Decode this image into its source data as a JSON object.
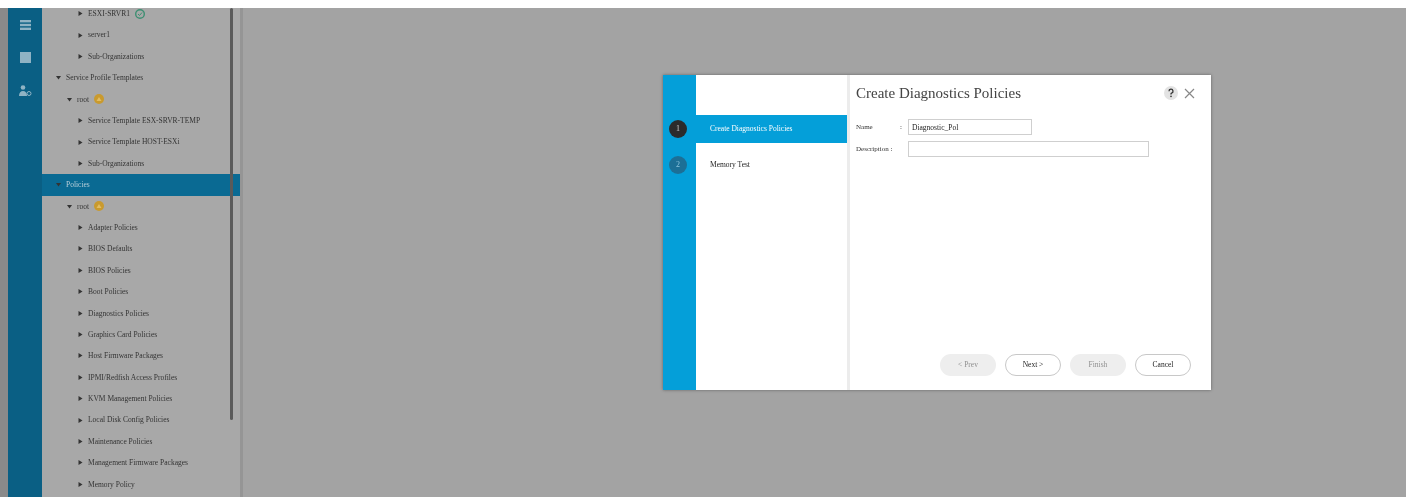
{
  "rail": {
    "icons": [
      {
        "kind": "menu",
        "selected": false
      },
      {
        "kind": "square",
        "selected": false
      },
      {
        "kind": "person",
        "selected": false
      }
    ]
  },
  "tree": {
    "cut_off_branch": [
      {
        "label": "ESXI-SRVR1",
        "badge": {
          "kind": "check"
        },
        "expanded": false
      },
      {
        "label": "server1",
        "expanded": false
      },
      {
        "label": "Sub-Organizations",
        "expanded": false
      }
    ],
    "items": [
      {
        "label": "Service Profile Templates",
        "expanded": true,
        "selected": false,
        "children": [
          {
            "label": "root",
            "badge": {
              "kind": "org"
            },
            "expanded": true,
            "selected": false,
            "children": [
              {
                "label": "Service Template ESX-SRVR-TEMP",
                "expanded": false,
                "selected": false
              },
              {
                "label": "Service Template HOST-ESXi",
                "expanded": false,
                "selected": false
              },
              {
                "label": "Sub-Organizations",
                "expanded": false,
                "selected": false
              }
            ]
          }
        ]
      },
      {
        "label": "Policies",
        "expanded": true,
        "selected": true,
        "children": [
          {
            "label": "root",
            "badge": {
              "kind": "org"
            },
            "expanded": true,
            "selected": false,
            "children": [
              {
                "label": "Adapter Policies",
                "expanded": false,
                "selected": false
              },
              {
                "label": "BIOS Defaults",
                "expanded": false,
                "selected": false
              },
              {
                "label": "BIOS Policies",
                "expanded": false,
                "selected": false
              },
              {
                "label": "Boot Policies",
                "expanded": false,
                "selected": false
              },
              {
                "label": "Diagnostics Policies",
                "expanded": false,
                "selected": false
              },
              {
                "label": "Graphics Card Policies",
                "expanded": false,
                "selected": false
              },
              {
                "label": "Host Firmware Packages",
                "expanded": false,
                "selected": false
              },
              {
                "label": "IPMI/Redfish Access Profiles",
                "expanded": false,
                "selected": false
              },
              {
                "label": "KVM Management Policies",
                "expanded": false,
                "selected": false
              },
              {
                "label": "Local Disk Config Policies",
                "expanded": false,
                "selected": false
              },
              {
                "label": "Maintenance Policies",
                "expanded": false,
                "selected": false
              },
              {
                "label": "Management Firmware Packages",
                "expanded": false,
                "selected": false
              },
              {
                "label": "Memory Policy",
                "expanded": false,
                "selected": false
              }
            ]
          }
        ]
      }
    ]
  },
  "dialog": {
    "title": "Create Diagnostics Policies",
    "steps": [
      {
        "number": "1",
        "label": "Create Diagnostics Policies",
        "selected": true
      },
      {
        "number": "2",
        "label": "Memory Test",
        "selected": false
      }
    ],
    "fields": [
      {
        "label": "Name",
        "separator": ":",
        "value": "Diagnostic_Pol",
        "wide": false
      },
      {
        "label": "Description :",
        "wide": true
      }
    ],
    "buttons": [
      {
        "label": "< Prev",
        "disabled": true
      },
      {
        "label": "Next >",
        "disabled": false
      },
      {
        "label": "Finish",
        "disabled": true
      },
      {
        "label": "Cancel",
        "disabled": false
      }
    ]
  }
}
